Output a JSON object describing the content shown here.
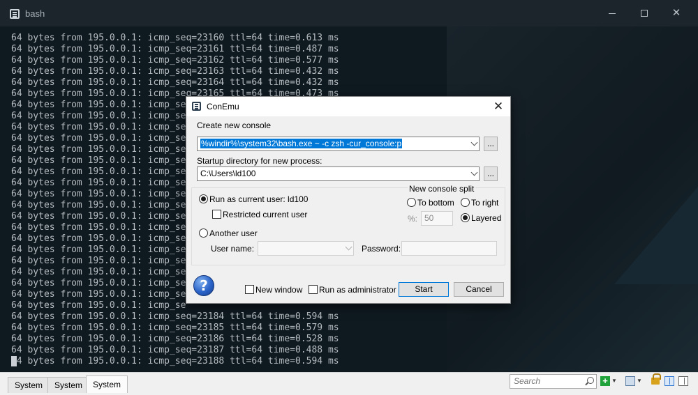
{
  "window": {
    "title": "bash",
    "icon": "conemu-icon",
    "controls": [
      "minimize",
      "maximize",
      "close"
    ]
  },
  "terminal": {
    "lines": [
      "64 bytes from 195.0.0.1: icmp_seq=23160 ttl=64 time=0.613 ms",
      "64 bytes from 195.0.0.1: icmp_seq=23161 ttl=64 time=0.487 ms",
      "64 bytes from 195.0.0.1: icmp_seq=23162 ttl=64 time=0.577 ms",
      "64 bytes from 195.0.0.1: icmp_seq=23163 ttl=64 time=0.432 ms",
      "64 bytes from 195.0.0.1: icmp_seq=23164 ttl=64 time=0.432 ms",
      "64 bytes from 195.0.0.1: icmp_seq=23165 ttl=64 time=0.473 ms",
      "64 bytes from 195.0.0.1: icmp_se",
      "64 bytes from 195.0.0.1: icmp_se",
      "64 bytes from 195.0.0.1: icmp_se",
      "64 bytes from 195.0.0.1: icmp_se",
      "64 bytes from 195.0.0.1: icmp_se",
      "64 bytes from 195.0.0.1: icmp_se",
      "64 bytes from 195.0.0.1: icmp_se",
      "64 bytes from 195.0.0.1: icmp_se",
      "64 bytes from 195.0.0.1: icmp_se",
      "64 bytes from 195.0.0.1: icmp_se",
      "64 bytes from 195.0.0.1: icmp_se",
      "64 bytes from 195.0.0.1: icmp_se",
      "64 bytes from 195.0.0.1: icmp_se",
      "64 bytes from 195.0.0.1: icmp_se",
      "64 bytes from 195.0.0.1: icmp_se",
      "64 bytes from 195.0.0.1: icmp_se",
      "64 bytes from 195.0.0.1: icmp_se",
      "64 bytes from 195.0.0.1: icmp_se",
      "64 bytes from 195.0.0.1: icmp_se",
      "64 bytes from 195.0.0.1: icmp_seq=23184 ttl=64 time=0.594 ms",
      "64 bytes from 195.0.0.1: icmp_seq=23185 ttl=64 time=0.579 ms",
      "64 bytes from 195.0.0.1: icmp_seq=23186 ttl=64 time=0.528 ms",
      "64 bytes from 195.0.0.1: icmp_seq=23187 ttl=64 time=0.488 ms",
      "64 bytes from 195.0.0.1: icmp_seq=23188 ttl=64 time=0.594 ms"
    ]
  },
  "statusbar": {
    "tabs": [
      "System",
      "System",
      "System"
    ],
    "search_placeholder": "Search",
    "icons": [
      "add-console-icon",
      "dropdown-icon",
      "window-icon",
      "dropdown-icon",
      "lock-icon",
      "split-vertical-icon",
      "split-panel-icon"
    ]
  },
  "dialog": {
    "title": "ConEmu",
    "close_label": "✕",
    "create_label": "Create new console",
    "command_value": "%windir%\\system32\\bash.exe ~ -c zsh -cur_console:p",
    "browse_label": "...",
    "startup_label": "Startup directory for new process:",
    "startup_value": "C:\\Users\\ld100",
    "run_as_current_label": "Run as current user: ld100",
    "restricted_label": "Restricted current user",
    "another_user_label": "Another user",
    "user_name_label": "User name:",
    "password_label": "Password:",
    "split_group_label": "New console split",
    "to_bottom_label": "To bottom",
    "to_right_label": "To right",
    "percent_label": "%:",
    "percent_value": "50",
    "layered_label": "Layered",
    "help_label": "?",
    "new_window_label": "New window",
    "run_admin_label": "Run as administrator",
    "start_label": "Start",
    "cancel_label": "Cancel",
    "selected_option": "run-as-current-user",
    "selected_split": "layered"
  }
}
